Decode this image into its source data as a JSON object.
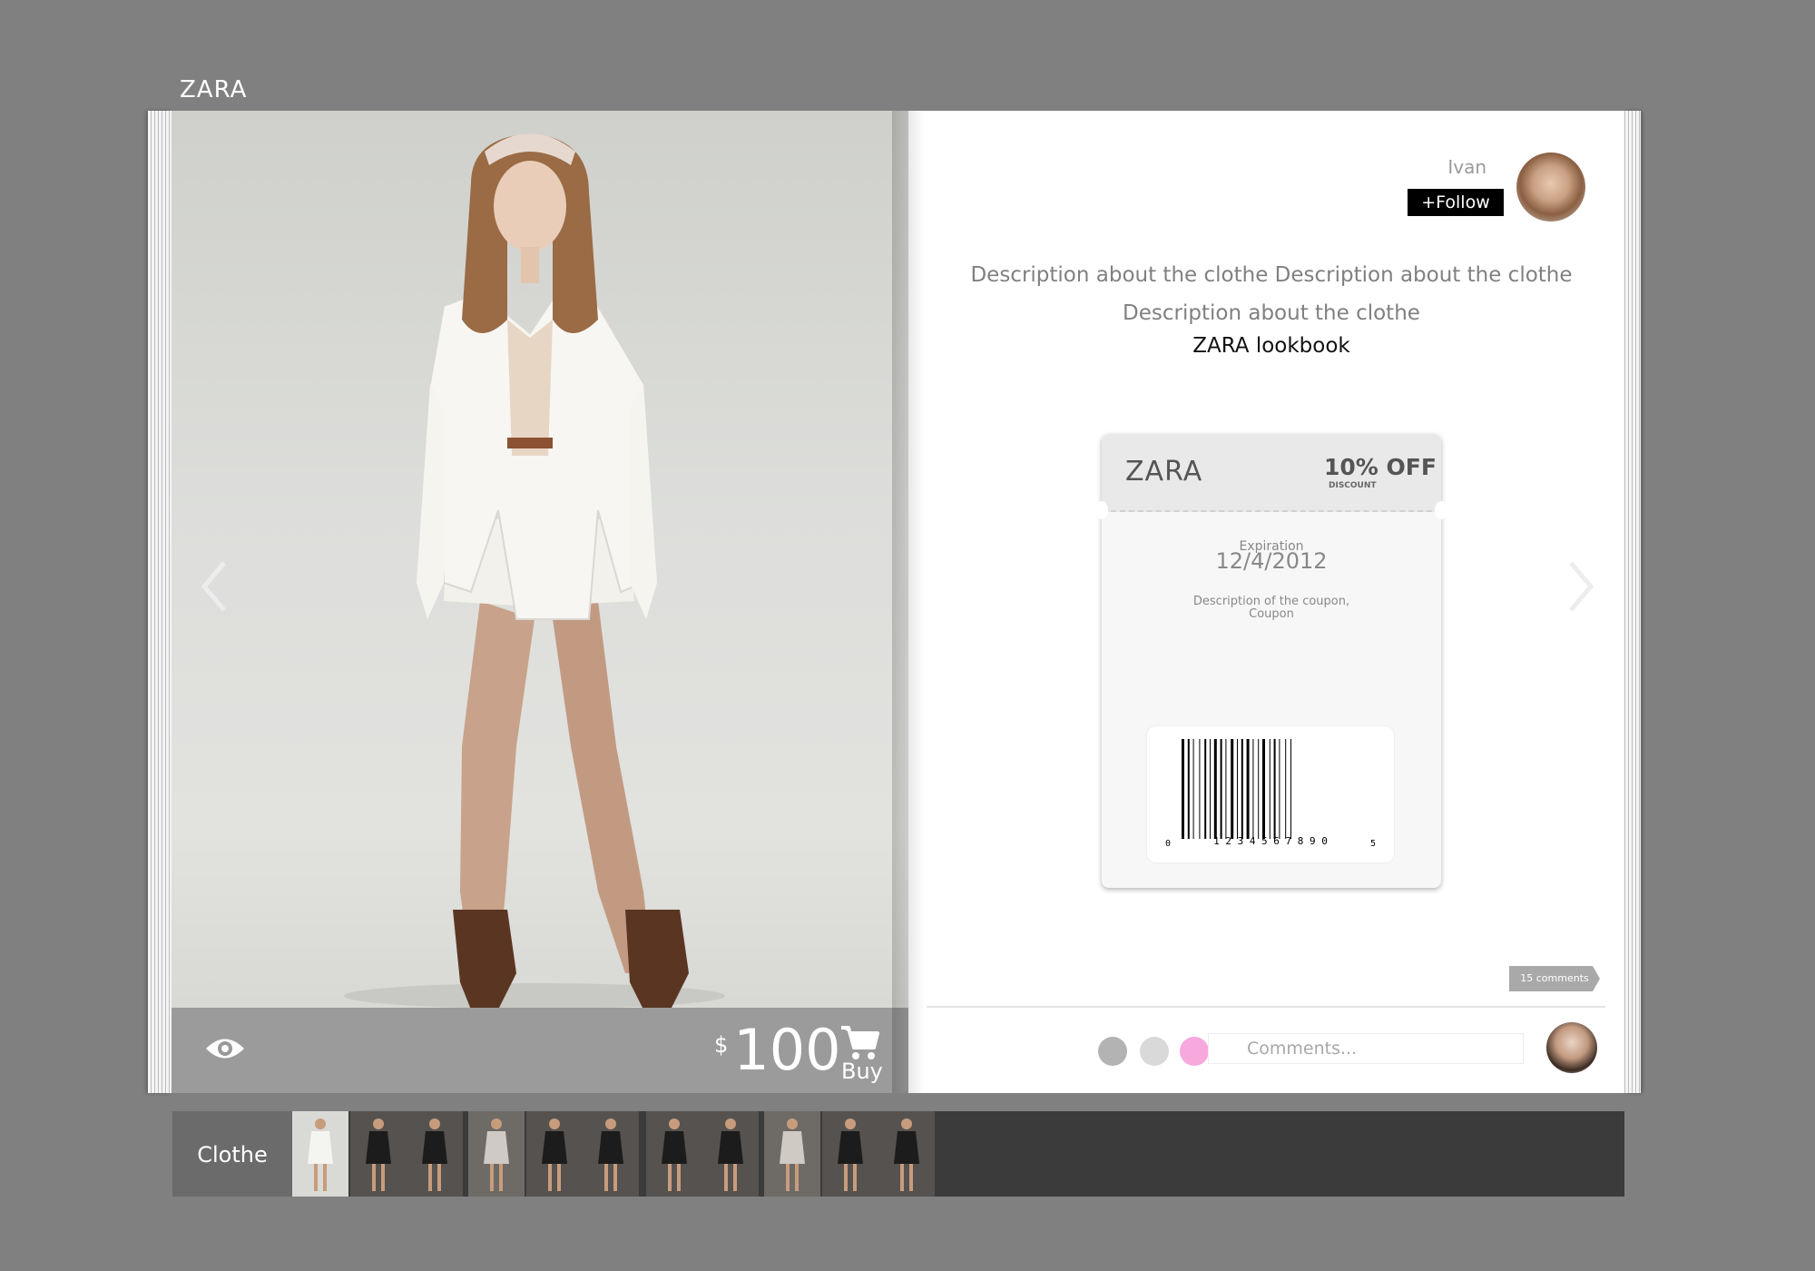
{
  "header": {
    "brand": "ZARA"
  },
  "product": {
    "currency": "$",
    "price": "100",
    "buy_label": "Buy"
  },
  "user": {
    "name": "Ivan",
    "follow_label": "+Follow"
  },
  "details": {
    "description": "Description about the clothe Description about the clothe Description about the clothe",
    "lookbook": "ZARA lookbook"
  },
  "coupon": {
    "brand": "ZARA",
    "discount": "10% OFF",
    "discount_label": "DISCOUNT",
    "expiration_label": "Expiration",
    "expiration_date": "12/4/2012",
    "description": "Description of the coupon, Coupon",
    "barcode_digits": {
      "first": "0",
      "middle": "1 2 3 4 5 6 7 8 9 0",
      "last": "5"
    }
  },
  "social": {
    "comments_count": "15 comments",
    "comment_placeholder": "Comments..."
  },
  "colors": {
    "swatches": [
      "#b3b3b3",
      "#d9d9d9",
      "#f7a8dd"
    ],
    "background": "#808080",
    "strip": "#3b3b3b"
  },
  "strip": {
    "label": "Clothe",
    "thumbnails": [
      {
        "outfit": "white"
      },
      {
        "outfit": "black"
      },
      {
        "outfit": "black"
      },
      {
        "outfit": "light"
      },
      {
        "outfit": "black"
      },
      {
        "outfit": "black"
      },
      {
        "outfit": "black"
      },
      {
        "outfit": "black"
      },
      {
        "outfit": "light"
      },
      {
        "outfit": "black"
      },
      {
        "outfit": "black"
      }
    ]
  }
}
